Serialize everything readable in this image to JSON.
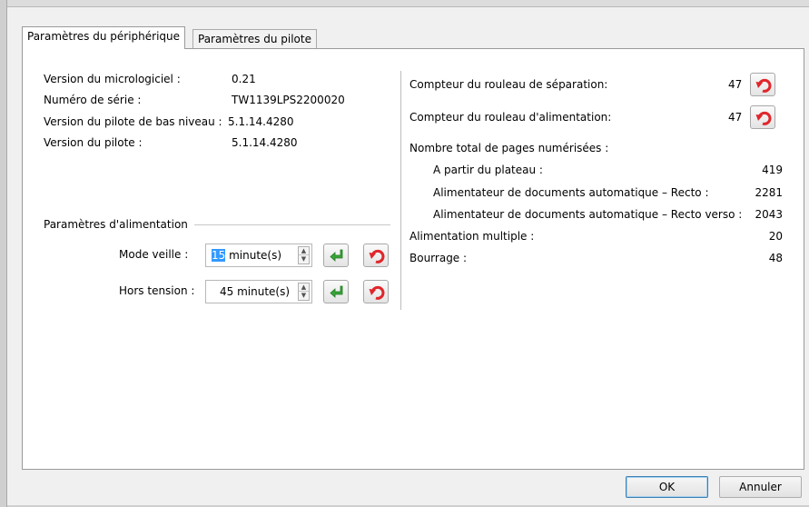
{
  "tabs": [
    {
      "label": "Paramètres du périphérique"
    },
    {
      "label": "Paramètres du pilote"
    }
  ],
  "info": [
    {
      "label": "Version du micrologiciel :",
      "value": "0.21"
    },
    {
      "label": "Numéro de série :",
      "value": "TW1139LPS2200020"
    },
    {
      "label": "Version du pilote de bas niveau :",
      "value": "5.1.14.4280"
    },
    {
      "label": "Version du pilote :",
      "value": "5.1.14.4280"
    }
  ],
  "power": {
    "group_title": "Paramètres d'alimentation",
    "sleep": {
      "label": "Mode veille :",
      "value_selected": "15",
      "unit": " minute(s)"
    },
    "off": {
      "label": "Hors tension :",
      "value": "45",
      "unit": " minute(s)"
    }
  },
  "counters": {
    "separation": {
      "label": "Compteur du rouleau de séparation:",
      "value": "47"
    },
    "feed": {
      "label": "Compteur du rouleau d'alimentation:",
      "value": "47"
    },
    "total_label": "Nombre total de pages numérisées :",
    "flatbed": {
      "label": "A partir du plateau :",
      "value": "419"
    },
    "adf_simplex": {
      "label": "Alimentateur de documents automatique – Recto :",
      "value": "2281"
    },
    "adf_duplex": {
      "label": "Alimentateur de documents automatique – Recto verso :",
      "value": "2043"
    },
    "multifeed": {
      "label": "Alimentation multiple :",
      "value": "20"
    },
    "jam": {
      "label": "Bourrage :",
      "value": "48"
    }
  },
  "buttons": {
    "ok": "OK",
    "cancel": "Annuler"
  },
  "colors": {
    "apply_green": "#3aa53a",
    "reset_red": "#e0262b",
    "selection": "#3399ff"
  },
  "icons": {
    "apply": "green-enter-arrow-icon",
    "reset": "red-undo-arrow-icon"
  }
}
